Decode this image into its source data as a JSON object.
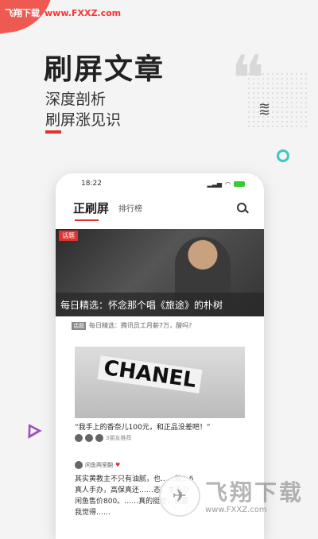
{
  "watermark_top": {
    "site": "飞翔下载",
    "domain": "www.FXXZ.com"
  },
  "hero": {
    "title": "刷屏文章",
    "subtitle_line1": "深度剖析",
    "subtitle_line2": "刷屏涨见识"
  },
  "phone": {
    "status_time": "18:22",
    "tabs": {
      "main": "正刷屏",
      "secondary": "排行榜"
    },
    "featured": {
      "tag": "话题",
      "caption": "每日精选：怀念那个唱《旅途》的朴树"
    },
    "news_line": {
      "tag": "话题",
      "text": "每日精选：腾讯员工月薪7万，酸吗?"
    },
    "card2": {
      "image_text": "CHANEL",
      "title": "“我手上的香奈儿100元，和正品没差吧！”",
      "meta": "3朋友推荐"
    },
    "card3": {
      "author": "闲鱼两室翻",
      "body": "其实黄教主不只有油腻，也……款1:6真人手办，高保真还……态。本手办闲鱼售价800。……真的挺瘦，我要我觉得……"
    }
  },
  "watermark_bottom": {
    "title": "飞翔下载",
    "url": "www.FXXZ.com"
  },
  "colors": {
    "accent": "#e0322f",
    "teal": "#3ec7c0",
    "purple": "#a04fbf"
  }
}
